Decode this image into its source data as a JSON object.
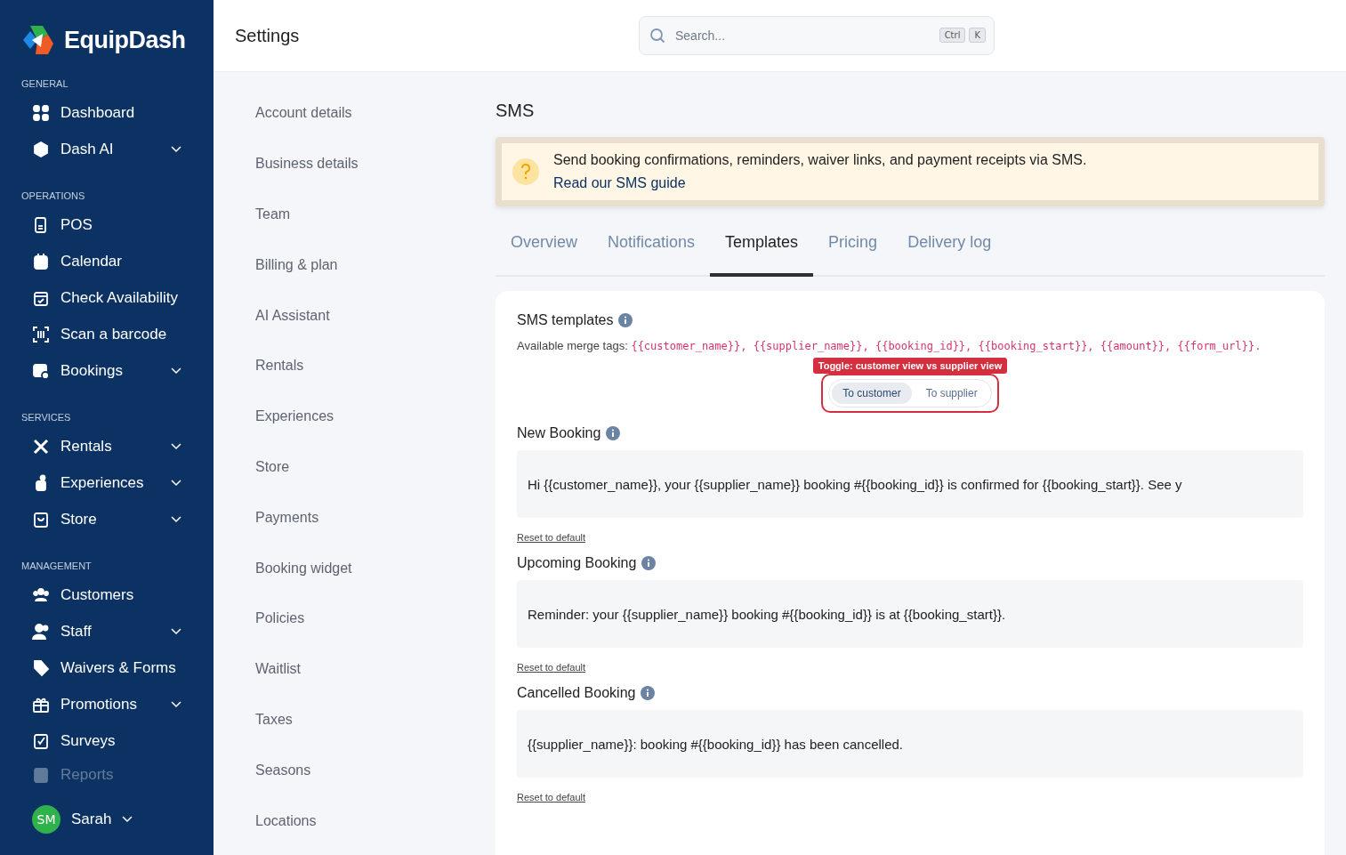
{
  "sidebar": {
    "brand": "EquipDash",
    "sections": [
      {
        "title": "GENERAL",
        "items": [
          {
            "label": "Dashboard",
            "expandable": false,
            "faded": false
          },
          {
            "label": "Dash AI",
            "expandable": true,
            "faded": false
          }
        ]
      },
      {
        "title": "OPERATIONS",
        "items": [
          {
            "label": "POS",
            "expandable": false,
            "faded": false
          },
          {
            "label": "Calendar",
            "expandable": false,
            "faded": false
          },
          {
            "label": "Check Availability",
            "expandable": false,
            "faded": false
          },
          {
            "label": "Scan a barcode",
            "expandable": false,
            "faded": false
          },
          {
            "label": "Bookings",
            "expandable": true,
            "faded": false
          }
        ]
      },
      {
        "title": "SERVICES",
        "items": [
          {
            "label": "Rentals",
            "expandable": true,
            "faded": false
          },
          {
            "label": "Experiences",
            "expandable": true,
            "faded": false
          },
          {
            "label": "Store",
            "expandable": true,
            "faded": false
          }
        ]
      },
      {
        "title": "MANAGEMENT",
        "items": [
          {
            "label": "Customers",
            "expandable": false,
            "faded": false
          },
          {
            "label": "Staff",
            "expandable": true,
            "faded": false
          },
          {
            "label": "Waivers & Forms",
            "expandable": false,
            "faded": false
          },
          {
            "label": "Promotions",
            "expandable": true,
            "faded": false
          },
          {
            "label": "Surveys",
            "expandable": false,
            "faded": false
          },
          {
            "label": "Reports",
            "expandable": false,
            "faded": true
          }
        ]
      }
    ],
    "user": {
      "initials": "SM",
      "name": "Sarah"
    }
  },
  "header": {
    "title": "Settings",
    "search": {
      "placeholder": "Search...",
      "keys": [
        "Ctrl",
        "K"
      ]
    }
  },
  "settings_nav": [
    "Account details",
    "Business details",
    "Team",
    "Billing & plan",
    "AI Assistant",
    "Rentals",
    "Experiences",
    "Store",
    "Payments",
    "Booking widget",
    "Policies",
    "Waitlist",
    "Taxes",
    "Seasons",
    "Locations"
  ],
  "page": {
    "title": "SMS",
    "notice": {
      "text": "Send booking confirmations, reminders, waiver links, and payment receipts via SMS.",
      "link": "Read our SMS guide"
    },
    "tabs": [
      {
        "label": "Overview",
        "selected": false
      },
      {
        "label": "Notifications",
        "selected": false
      },
      {
        "label": "Templates",
        "selected": true
      },
      {
        "label": "Pricing",
        "selected": false
      },
      {
        "label": "Delivery log",
        "selected": false
      }
    ],
    "templates": {
      "title": "SMS templates",
      "merge_label": "Available merge tags:",
      "merge_tags": "{{customer_name}}, {{supplier_name}}, {{booking_id}}, {{booking_start}}, {{amount}}, {{form_url}}.",
      "tooltip": "Toggle: customer view vs supplier view",
      "toggle": [
        {
          "label": "To customer",
          "selected": true
        },
        {
          "label": "To supplier",
          "selected": false
        }
      ],
      "items": [
        {
          "title": "New Booking",
          "message": "Hi {{customer_name}}, your {{supplier_name}} booking #{{booking_id}} is confirmed for {{booking_start}}. See y",
          "reset": "Reset to default"
        },
        {
          "title": "Upcoming Booking",
          "message": "Reminder: your {{supplier_name}} booking #{{booking_id}} is at {{booking_start}}.",
          "reset": "Reset to default"
        },
        {
          "title": "Cancelled Booking",
          "message": "{{supplier_name}}: booking #{{booking_id}} has been cancelled.",
          "reset": "Reset to default"
        }
      ]
    }
  }
}
